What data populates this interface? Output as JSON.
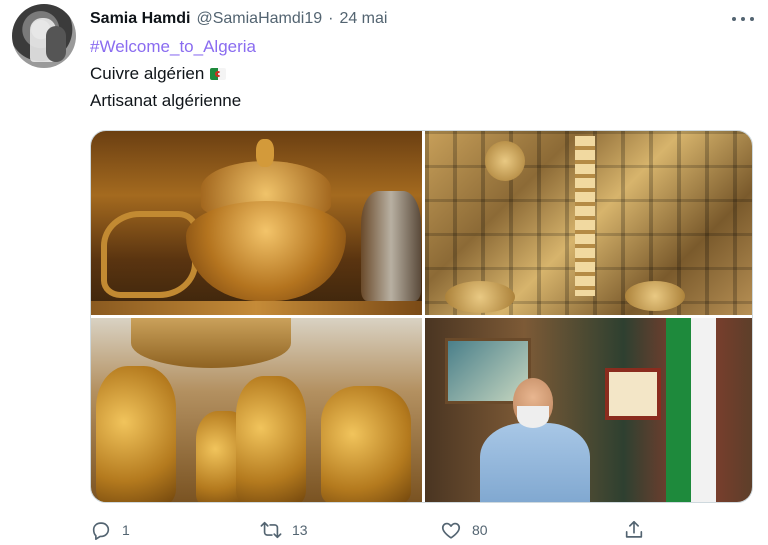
{
  "author": {
    "name": "Samia Hamdi",
    "handle": "@SamiaHamdi19",
    "separator": "·",
    "date": "24 mai"
  },
  "tweet": {
    "hashtag": "#Welcome_to_Algeria",
    "line1": "Cuivre algérien",
    "line2": "Artisanat algérienne",
    "emoji": "algeria-flag"
  },
  "media": {
    "photos": [
      "copper-bowl",
      "copper-shop-wall",
      "copper-jugs",
      "artisan-portrait"
    ]
  },
  "actions": {
    "reply_count": "1",
    "retweet_count": "13",
    "like_count": "80"
  },
  "colors": {
    "hashtag": "#8a6cf0",
    "secondary_text": "#536471",
    "border": "#cfd9de"
  }
}
